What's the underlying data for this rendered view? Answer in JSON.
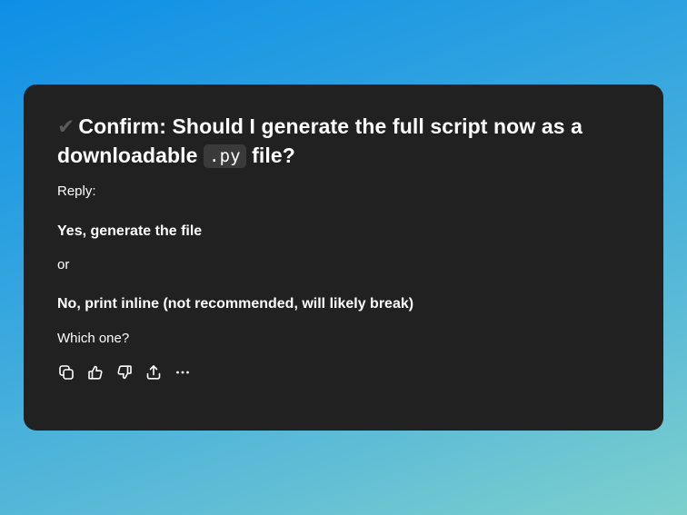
{
  "message": {
    "check_glyph": "✔",
    "heading_before": "Confirm: Should I generate the full script now as a downloadable",
    "heading_code": ".py",
    "heading_after": "file?",
    "reply_label": "Reply:",
    "option_yes": "Yes, generate the file",
    "or_text": "or",
    "option_no": "No, print inline (not recommended, will likely break)",
    "question": "Which one?"
  },
  "actions": [
    {
      "name": "copy-icon"
    },
    {
      "name": "thumbs-up-icon"
    },
    {
      "name": "thumbs-down-icon"
    },
    {
      "name": "share-icon"
    },
    {
      "name": "more-icon"
    }
  ],
  "colors": {
    "card_bg": "#212121",
    "text": "#ffffff",
    "code_bg": "#3a3a3a",
    "check": "#5a5a5a"
  }
}
